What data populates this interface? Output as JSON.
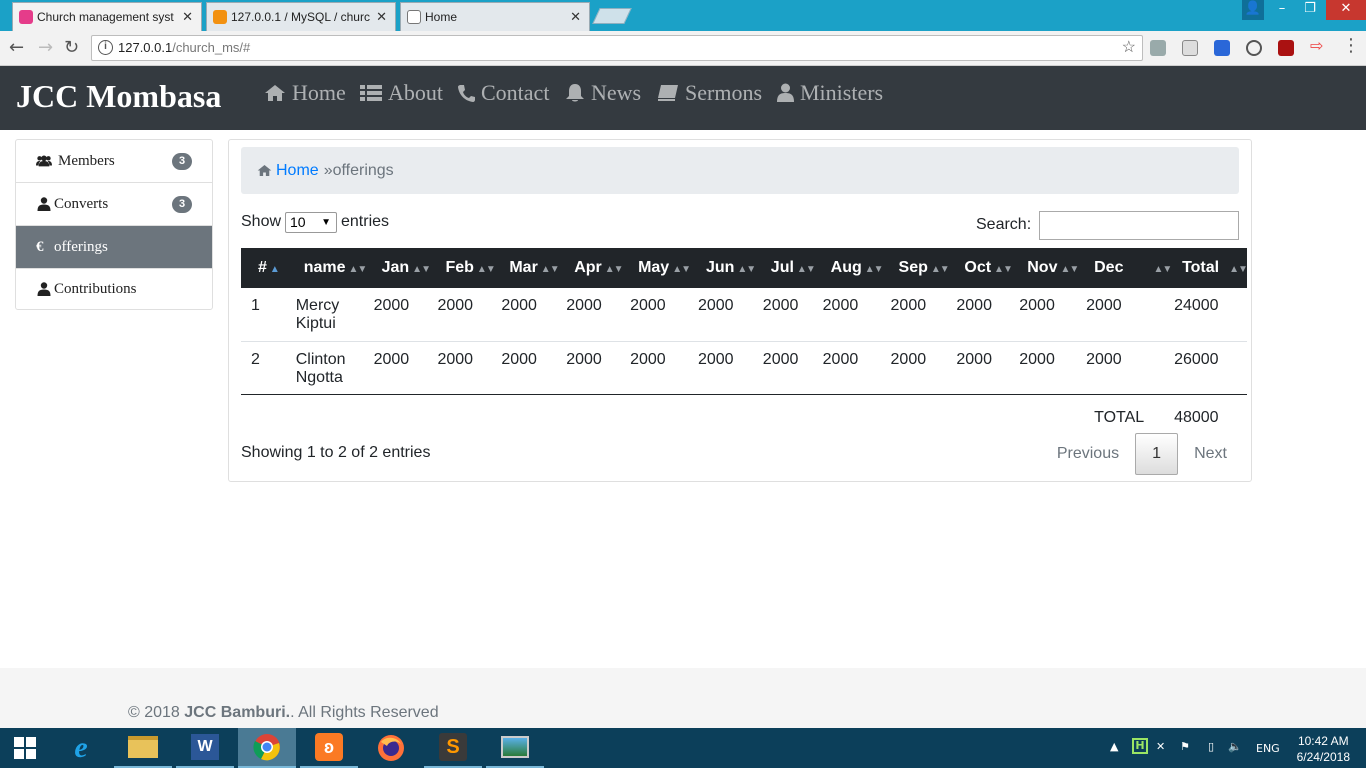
{
  "browser": {
    "tabs": [
      {
        "title": "Church management syst",
        "active": true
      },
      {
        "title": "127.0.0.1 / MySQL / churc",
        "active": false
      },
      {
        "title": "Home",
        "active": false
      }
    ],
    "url_host": "127.0.0.1",
    "url_path": "/church_ms/#"
  },
  "site": {
    "brand": "JCC Mombasa",
    "nav": [
      "Home",
      "About",
      "Contact",
      "News",
      "Sermons",
      "Ministers"
    ]
  },
  "sidebar": {
    "items": [
      {
        "label": "Members",
        "badge": "3",
        "icon": "users-icon"
      },
      {
        "label": "Converts",
        "badge": "3",
        "icon": "user-icon"
      },
      {
        "label": "offerings",
        "badge": null,
        "icon": "euro-icon",
        "active": true
      },
      {
        "label": "Contributions",
        "badge": null,
        "icon": "user-icon"
      }
    ]
  },
  "breadcrumb": {
    "home": "Home",
    "sep": "»",
    "current": "offerings"
  },
  "table_controls": {
    "show_label": "Show",
    "length_value": "10",
    "entries_label": "entries",
    "search_label": "Search:",
    "search_value": ""
  },
  "table": {
    "headers": [
      "#",
      "name",
      "Jan",
      "Feb",
      "Mar",
      "Apr",
      "May",
      "Jun",
      "Jul",
      "Aug",
      "Sep",
      "Oct",
      "Nov",
      "Dec",
      "Total"
    ],
    "rows": [
      [
        "1",
        "Mercy Kiptui",
        "2000",
        "2000",
        "2000",
        "2000",
        "2000",
        "2000",
        "2000",
        "2000",
        "2000",
        "2000",
        "2000",
        "2000",
        "24000"
      ],
      [
        "2",
        "Clinton Ngotta",
        "2000",
        "2000",
        "2000",
        "2000",
        "2000",
        "2000",
        "2000",
        "2000",
        "2000",
        "2000",
        "2000",
        "2000",
        "26000"
      ]
    ],
    "footer_label": "TOTAL",
    "footer_total": "48000"
  },
  "pagination": {
    "info": "Showing 1 to 2 of 2 entries",
    "previous": "Previous",
    "current": "1",
    "next": "Next"
  },
  "footer": {
    "prefix": "© 2018 ",
    "org": "JCC Bamburi.",
    "suffix": ". All Rights Reserved"
  },
  "taskbar": {
    "apps": [
      "start",
      "internet-explorer",
      "file-explorer",
      "word",
      "chrome",
      "xampp",
      "firefox",
      "sublime-text",
      "photos"
    ],
    "lang": "ENG",
    "time": "10:42 AM",
    "date": "6/24/2018"
  }
}
